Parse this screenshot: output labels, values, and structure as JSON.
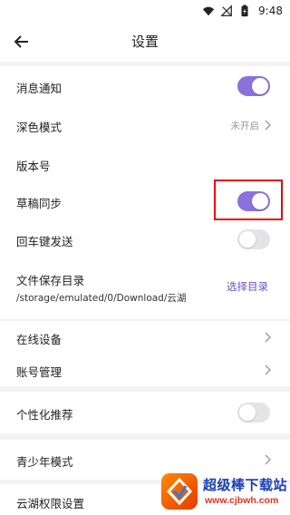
{
  "status_bar": {
    "time": "9:48",
    "icons": [
      "wifi-icon",
      "no-signal-icon",
      "battery-charging-icon"
    ]
  },
  "header": {
    "title": "设置",
    "back_icon": "arrow-left-icon"
  },
  "settings": {
    "message_notification": {
      "label": "消息通知",
      "enabled": true
    },
    "dark_mode": {
      "label": "深色模式",
      "value": "未开启"
    },
    "version": {
      "label": "版本号"
    },
    "draft_sync": {
      "label": "草稿同步",
      "enabled": true
    },
    "enter_to_send": {
      "label": "回车键发送",
      "enabled": false
    },
    "file_save_dir": {
      "label": "文件保存目录",
      "path": "/storage/emulated/0/Download/云湖",
      "action": "选择目录"
    },
    "online_devices": {
      "label": "在线设备"
    },
    "account_management": {
      "label": "账号管理"
    },
    "personalized_recommendation": {
      "label": "个性化推荐",
      "enabled": false
    },
    "teen_mode": {
      "label": "青少年模式"
    },
    "permissions": {
      "label": "云湖权限设置"
    }
  },
  "watermark": {
    "title": "超级棒下载站",
    "url": "www.cjbwh.com"
  },
  "colors": {
    "accent": "#8a72dc",
    "link": "#6a52c8",
    "toggle_off": "#e4e4e7",
    "highlight": "#ee0000",
    "background": "#f3f3f5"
  }
}
